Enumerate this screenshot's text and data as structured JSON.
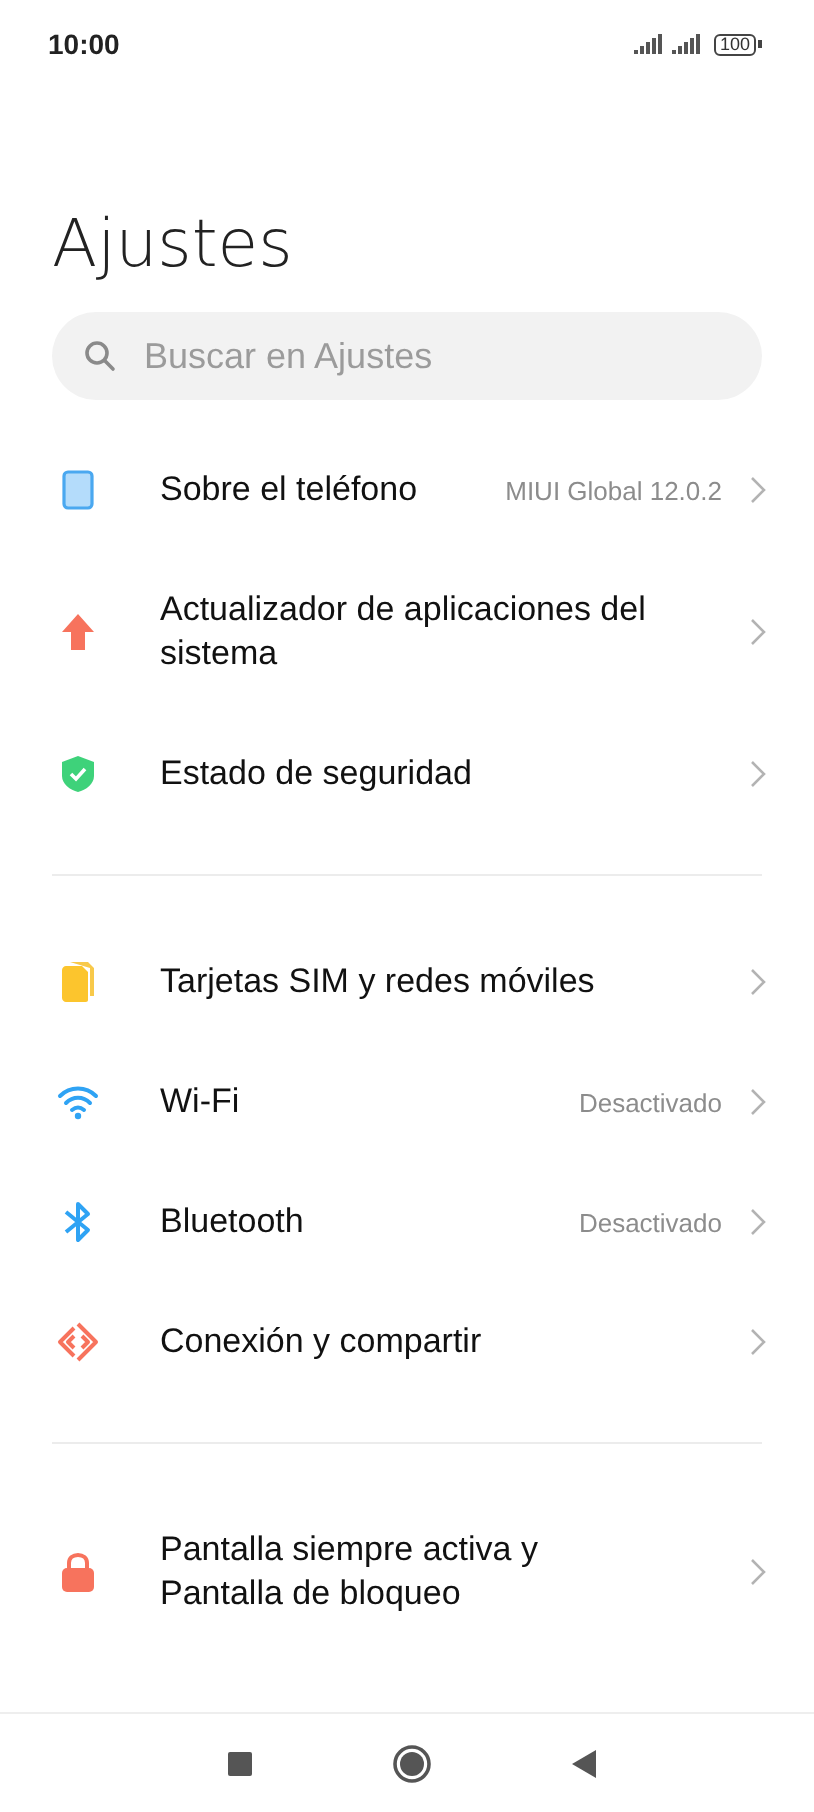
{
  "status_bar": {
    "time": "10:00",
    "battery": "100"
  },
  "title": "Ajustes",
  "search": {
    "placeholder": "Buscar en Ajustes"
  },
  "groups": [
    {
      "items": [
        {
          "label": "Sobre el teléfono",
          "value": "MIUI Global 12.0.2"
        },
        {
          "label": "Actualizador de aplicaciones del sistema"
        },
        {
          "label": "Estado de seguridad"
        }
      ]
    },
    {
      "items": [
        {
          "label": "Tarjetas SIM y redes móviles"
        },
        {
          "label": "Wi-Fi",
          "value": "Desactivado"
        },
        {
          "label": "Bluetooth",
          "value": "Desactivado"
        },
        {
          "label": "Conexión y compartir"
        }
      ]
    },
    {
      "items": [
        {
          "label": "Pantalla siempre activa y Pantalla de bloqueo"
        }
      ]
    }
  ]
}
